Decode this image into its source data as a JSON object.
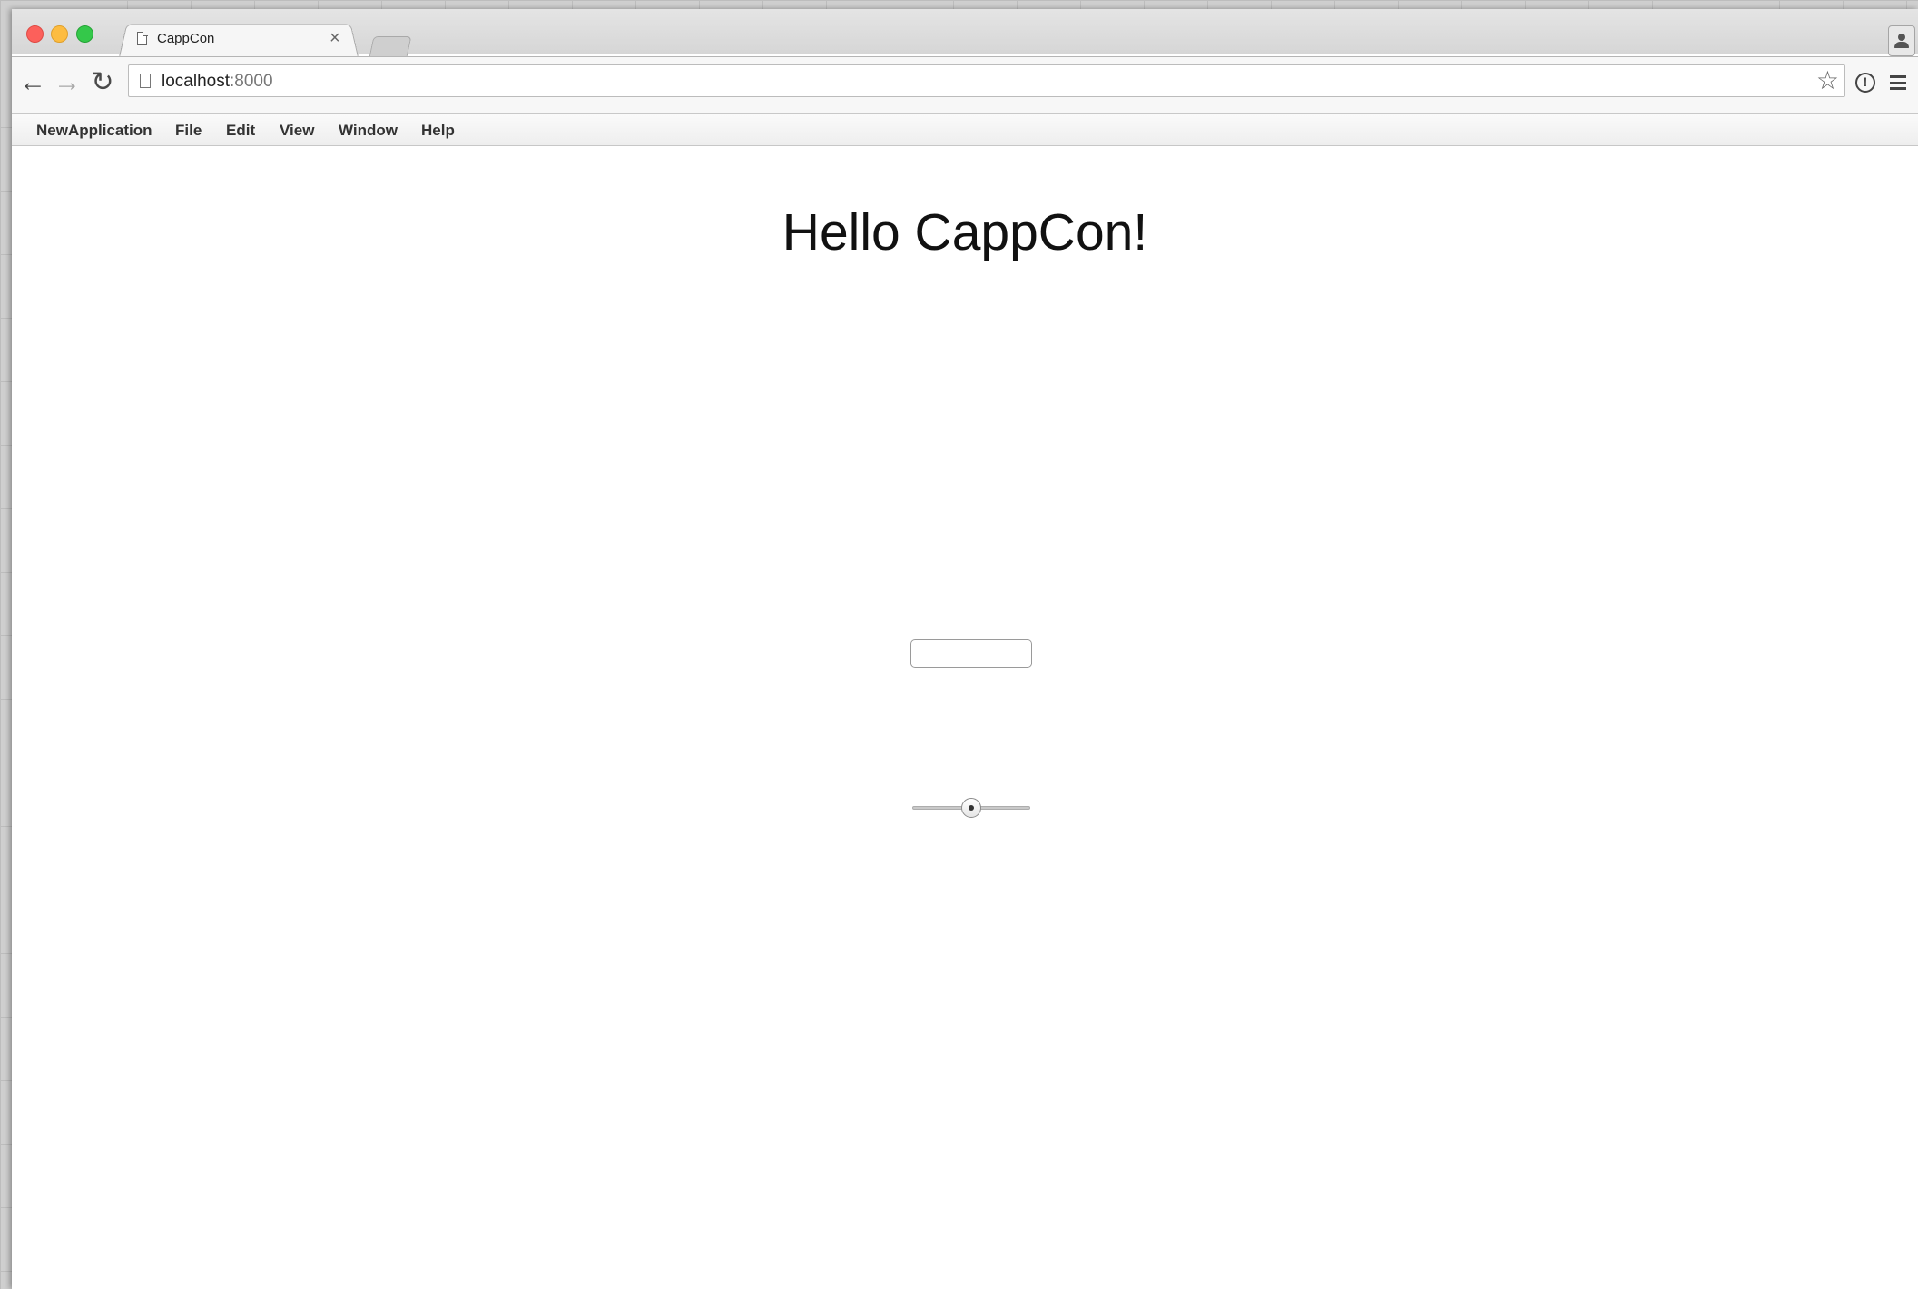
{
  "browser": {
    "tab_title": "CappCon",
    "tab_close": "×",
    "url_host": "localhost",
    "url_port": ":8000",
    "icons": {
      "back": "back-arrow-icon",
      "forward": "forward-arrow-icon",
      "reload": "reload-icon",
      "page": "page-icon",
      "star": "star-icon",
      "info": "info-icon",
      "menu": "hamburger-menu-icon",
      "profile": "profile-icon"
    }
  },
  "menubar": {
    "items": [
      "NewApplication",
      "File",
      "Edit",
      "View",
      "Window",
      "Help"
    ]
  },
  "main": {
    "headline": "Hello CappCon!",
    "text_field_value": "",
    "slider_value": 0.5
  }
}
